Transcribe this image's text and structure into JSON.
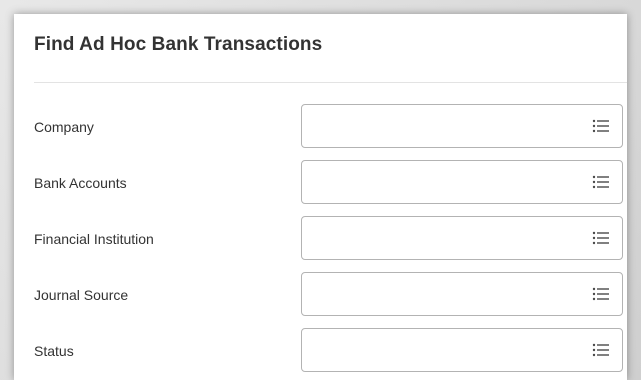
{
  "page": {
    "title": "Find Ad Hoc Bank Transactions"
  },
  "fields": [
    {
      "label": "Company",
      "value": "",
      "icon": "list-icon"
    },
    {
      "label": "Bank Accounts",
      "value": "",
      "icon": "list-icon"
    },
    {
      "label": "Financial Institution",
      "value": "",
      "icon": "list-icon"
    },
    {
      "label": "Journal Source",
      "value": "",
      "icon": "list-icon"
    },
    {
      "label": "Status",
      "value": "",
      "icon": "list-icon"
    }
  ],
  "colors": {
    "text": "#333333",
    "border": "#b3b3b3",
    "icon": "#4a4a4a"
  }
}
